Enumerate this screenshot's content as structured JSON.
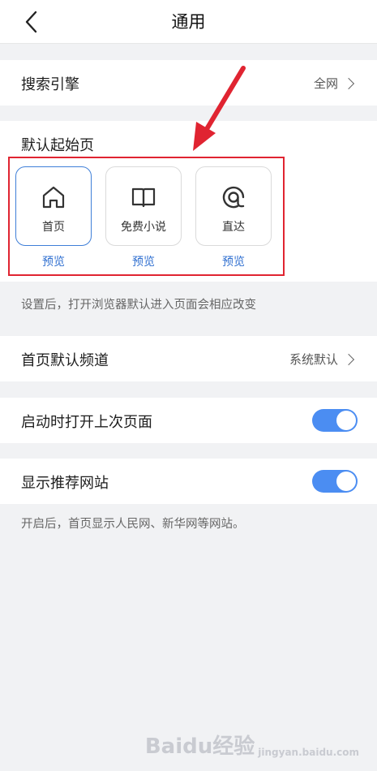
{
  "header": {
    "title": "通用",
    "back_icon": "chevron-left-icon"
  },
  "search_engine": {
    "label": "搜索引擎",
    "value": "全网"
  },
  "default_start_page": {
    "label": "默认起始页",
    "options": [
      {
        "label": "首页",
        "icon": "home-icon",
        "selected": true,
        "preview": "预览"
      },
      {
        "label": "免费小说",
        "icon": "book-icon",
        "selected": false,
        "preview": "预览"
      },
      {
        "label": "直达",
        "icon": "direct-icon",
        "selected": false,
        "preview": "预览"
      }
    ],
    "note": "设置后，打开浏览器默认进入页面会相应改变"
  },
  "home_channel": {
    "label": "首页默认频道",
    "value": "系统默认"
  },
  "open_last_page": {
    "label": "启动时打开上次页面",
    "enabled": true
  },
  "recommended_sites": {
    "label": "显示推荐网站",
    "enabled": true,
    "note": "开启后，首页显示人民网、新华网等网站。"
  },
  "colors": {
    "accent": "#4b8df2",
    "link": "#2f6fd0",
    "highlight": "#e02431",
    "background": "#f1f2f4"
  },
  "watermark": {
    "main": "Baidu经验",
    "sub": "jingyan.baidu.com"
  }
}
